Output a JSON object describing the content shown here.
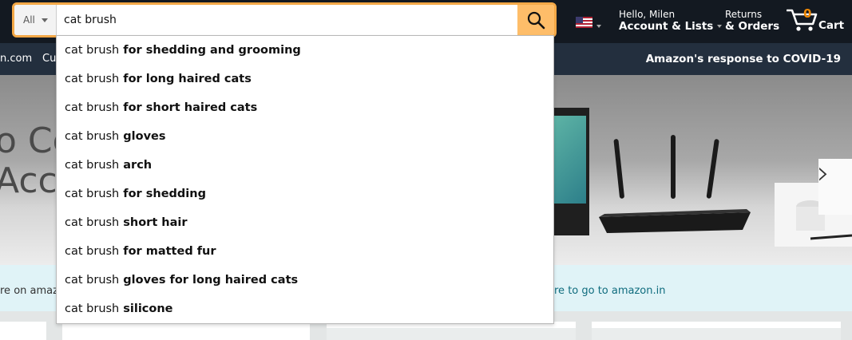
{
  "header": {
    "search": {
      "category": "All",
      "query": "cat brush"
    },
    "account": {
      "greeting": "Hello, Milen",
      "label": "Account & Lists"
    },
    "orders": {
      "line1": "Returns",
      "line2": "& Orders"
    },
    "cart": {
      "count": "0",
      "label": "Cart"
    },
    "icons": [
      "search-icon",
      "us-flag-icon",
      "cart-icon"
    ]
  },
  "nav": {
    "items": [
      "n.com",
      "Cu"
    ],
    "covid_link": "Amazon's response to COVID-19"
  },
  "hero": {
    "text_line1": "o Co",
    "text_line2": "Acce"
  },
  "strip": {
    "left_text": "re on amaz",
    "link_text": "ere to go to amazon.in"
  },
  "suggestions": [
    {
      "base": "cat brush",
      "completion": "for shedding and grooming"
    },
    {
      "base": "cat brush",
      "completion": "for long haired cats"
    },
    {
      "base": "cat brush",
      "completion": "for short haired cats"
    },
    {
      "base": "cat brush",
      "completion": "gloves"
    },
    {
      "base": "cat brush",
      "completion": "arch"
    },
    {
      "base": "cat brush",
      "completion": "for shedding"
    },
    {
      "base": "cat brush",
      "completion": "short hair"
    },
    {
      "base": "cat brush",
      "completion": "for matted fur"
    },
    {
      "base": "cat brush",
      "completion": "gloves for long haired cats"
    },
    {
      "base": "cat brush",
      "completion": "silicone"
    }
  ],
  "colors": {
    "header_bg": "#131921",
    "nav_bg": "#232f3e",
    "search_focus": "#f3a847",
    "search_button": "#febd69",
    "cart_count": "#f08804"
  }
}
